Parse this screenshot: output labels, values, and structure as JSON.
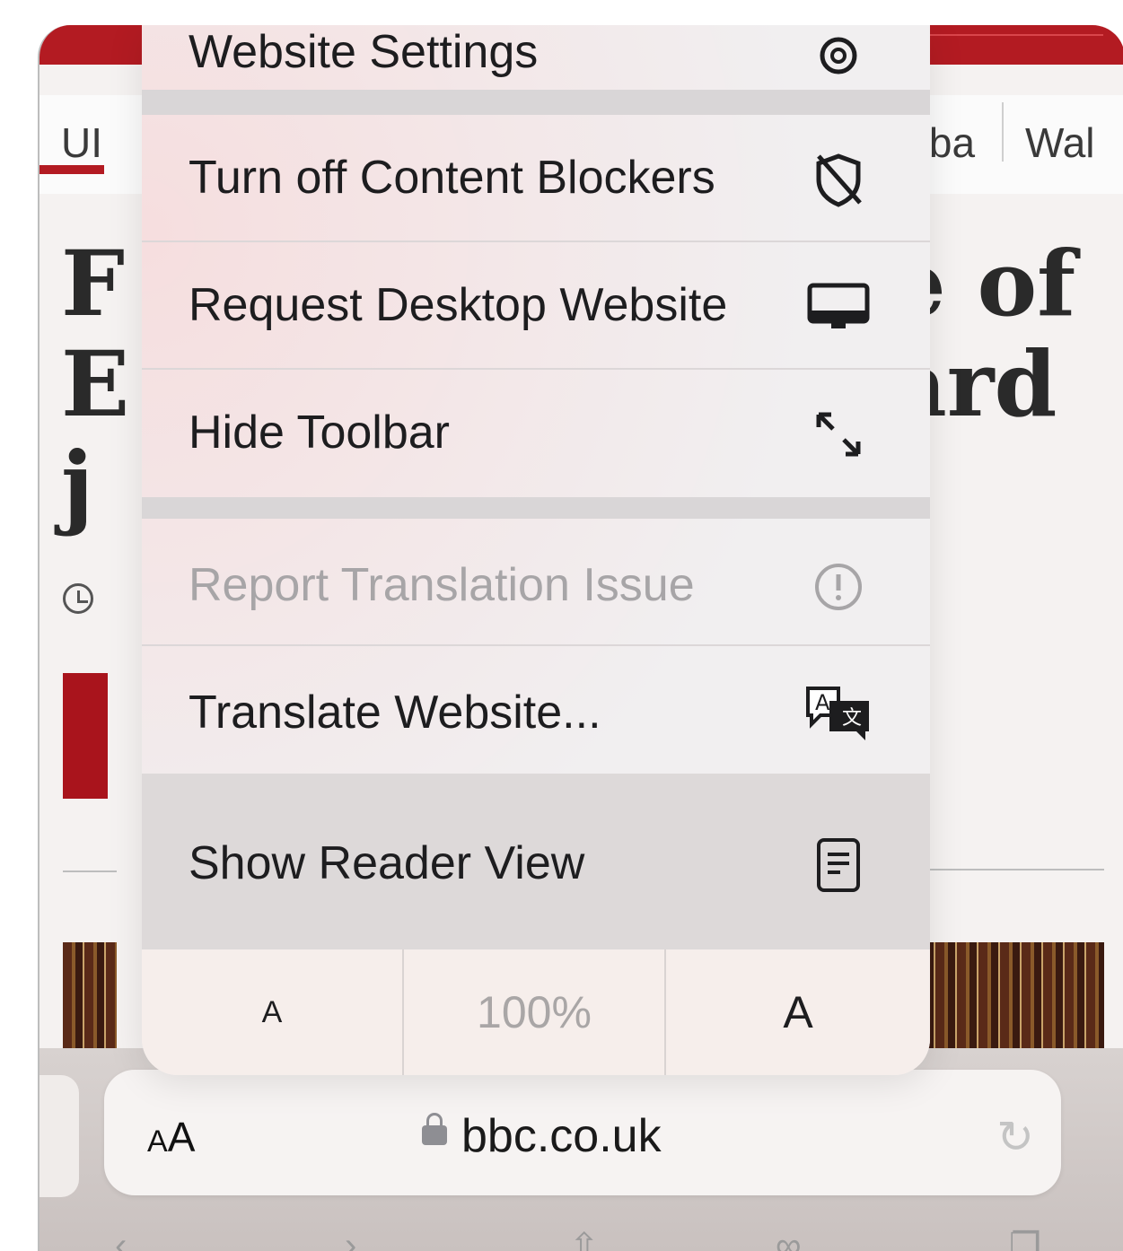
{
  "page": {
    "nav_items": [
      "UI",
      "Alba",
      "Wal"
    ],
    "headline_fragments": [
      "F",
      "E",
      "j",
      "e of",
      "ard"
    ]
  },
  "menu": {
    "items": [
      {
        "label": "Website Settings",
        "icon": "gear-icon",
        "enabled": true
      },
      {
        "label": "Turn off Content Blockers",
        "icon": "shield-slash-icon",
        "enabled": true
      },
      {
        "label": "Request Desktop Website",
        "icon": "desktop-icon",
        "enabled": true
      },
      {
        "label": "Hide Toolbar",
        "icon": "expand-arrows-icon",
        "enabled": true
      },
      {
        "label": "Report Translation Issue",
        "icon": "exclamation-circle-icon",
        "enabled": false
      },
      {
        "label": "Translate Website...",
        "icon": "translate-bubble-icon",
        "enabled": true
      },
      {
        "label": "Show Reader View",
        "icon": "reader-view-icon",
        "enabled": true
      }
    ],
    "text_size": {
      "smaller_label": "A",
      "zoom_value": "100%",
      "larger_label": "A"
    }
  },
  "toolbar": {
    "text_settings_label": "AA",
    "url": "bbc.co.uk",
    "reload_icon": "reload-icon"
  }
}
